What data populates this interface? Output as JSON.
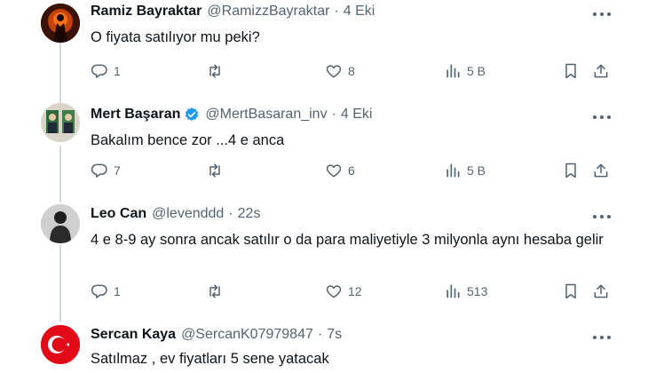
{
  "tweets": [
    {
      "name": "Ramiz Bayraktar",
      "handle": "@RamizzBayraktar",
      "sep": "·",
      "time": "4 Eki",
      "text": "O fiyata satılıyor mu peki?",
      "replies": "1",
      "retweets": "",
      "likes": "8",
      "views": "5 B",
      "verified": false
    },
    {
      "name": "Mert Başaran",
      "handle": "@MertBasaran_inv",
      "sep": "·",
      "time": "4 Eki",
      "text": "Bakalım bence zor ...4 e anca",
      "replies": "7",
      "retweets": "",
      "likes": "6",
      "views": "5 B",
      "verified": true
    },
    {
      "name": "Leo Can",
      "handle": "@levenddd",
      "sep": "·",
      "time": "22s",
      "text": "4 e 8-9 ay sonra ancak satılır o da para maliyetiyle 3 milyonla aynı hesaba gelir",
      "replies": "1",
      "retweets": "",
      "likes": "12",
      "views": "513",
      "verified": false
    },
    {
      "name": "Sercan Kaya",
      "handle": "@SercanK07979847",
      "sep": "·",
      "time": "7s",
      "text": "Satılmaz , ev fiyatları 5 sene yatacak",
      "verified": false
    }
  ],
  "colors": {
    "text": "#0f1419",
    "muted": "#536471",
    "verified": "#1d9bf0",
    "thread_line": "#cfd9de"
  }
}
